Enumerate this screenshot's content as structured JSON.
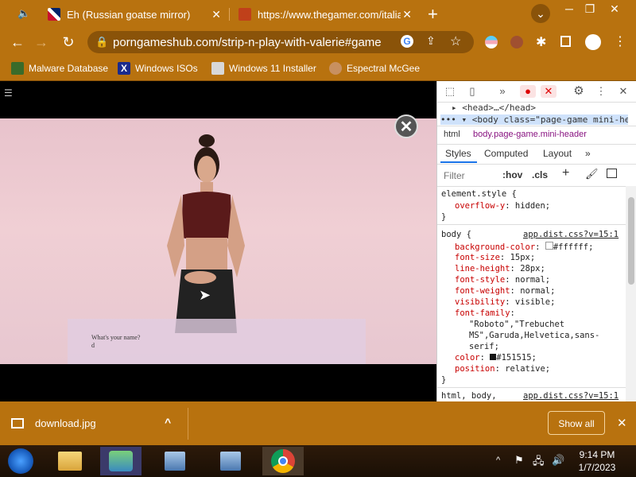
{
  "tabs": [
    {
      "title": "Eh (Russian goatse mirror)",
      "close": "✕"
    },
    {
      "title": "https://www.thegamer.com/italia",
      "close": "✕"
    }
  ],
  "new_tab": "+",
  "window_buttons": {
    "menu": "⌄",
    "minimize": "─",
    "restore": "❐",
    "close": "✕"
  },
  "toolbar": {
    "back": "←",
    "forward": "→",
    "reload": "↻",
    "url": "porngameshub.com/strip-n-play-with-valerie#game"
  },
  "bookmarks": [
    {
      "label": "Malware Database",
      "color": "#3a6b2a"
    },
    {
      "label": "Windows ISOs",
      "color": "#1a2a8c"
    },
    {
      "label": "Windows 11 Installer",
      "color": "#d8d8d8"
    },
    {
      "label": "Espectral McGee",
      "color": "#c89060"
    }
  ],
  "page": {
    "menu_icon": "☰",
    "game_close": "✕",
    "dialog_question": "What's your name?",
    "dialog_answer": "d"
  },
  "devtools": {
    "tree": [
      {
        "text": "▸ <head>…</head>"
      },
      {
        "text": "••• ▾ <body class=\"page-game mini-hea"
      }
    ],
    "breadcrumb": [
      "html",
      "body.page-game.mini-header"
    ],
    "tabs": [
      "Styles",
      "Computed",
      "Layout",
      "»"
    ],
    "filter_placeholder": "Filter",
    "hov": ":hov",
    "cls": ".cls",
    "styles": {
      "element_selector": "element.style {",
      "element_prop": "overflow-y",
      "element_val": "hidden;",
      "close1": "}",
      "body_selector": "body {",
      "body_src": "app.dist.css?v=15:1",
      "props": [
        {
          "name": "background-color",
          "val": "#ffffff;"
        },
        {
          "name": "font-size",
          "val": "15px;"
        },
        {
          "name": "line-height",
          "val": "28px;"
        },
        {
          "name": "font-style",
          "val": "normal;"
        },
        {
          "name": "font-weight",
          "val": "normal;"
        },
        {
          "name": "visibility",
          "val": "visible;"
        },
        {
          "name": "font-family",
          "val": ""
        }
      ],
      "font_family_lines": [
        "\"Roboto\",\"Trebuchet",
        "MS\",Garuda,Helvetica,sans-",
        "serif;"
      ],
      "color_prop": "color",
      "color_val": "#151515;",
      "position_prop": "position",
      "position_val": "relative;",
      "close2": "}",
      "next_selector": "html, body,",
      "next_src": "app.dist.css?v=15:1"
    }
  },
  "download": {
    "filename": "download.jpg",
    "chevron": "^",
    "show_all": "Show all",
    "close": "✕"
  },
  "taskbar": {
    "time": "9:14 PM",
    "date": "1/7/2023",
    "tray_up": "^"
  },
  "colors": {
    "chrome": "#b8720f",
    "omnibox": "#8a5309"
  }
}
